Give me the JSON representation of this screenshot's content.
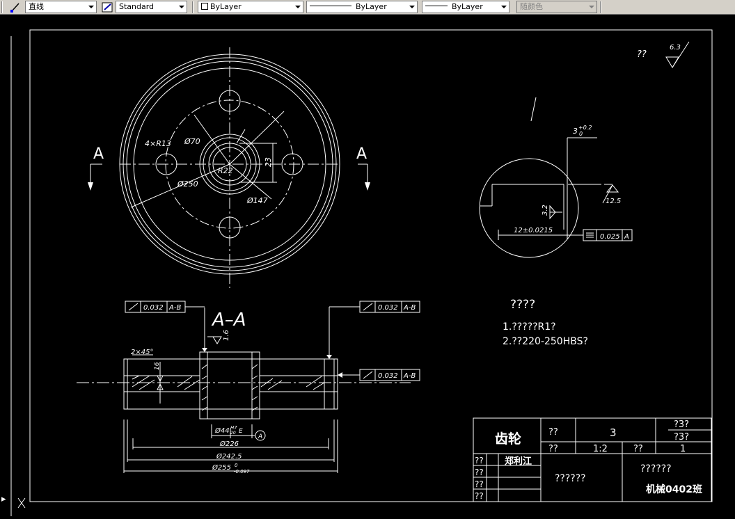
{
  "toolbar": {
    "command_combo": "直线",
    "style_combo": "Standard",
    "layer_combo": "ByLayer",
    "linetype_combo": "ByLayer",
    "lineweight_combo": "ByLayer",
    "color_combo": "随颜色"
  },
  "drawing": {
    "top_view": {
      "section_left": "A",
      "section_right": "A",
      "dim_4xr13": "4×R13",
      "dim_d70": "Ø70",
      "dim_r22": "R22",
      "dim_23": "23",
      "dim_d250": "Ø250",
      "dim_d147": "Ø147"
    },
    "detail": {
      "dim_3": "3",
      "dim_3_tol": "+0.2",
      "dim_3_tol_low": "0",
      "rough_12_5": "12.5",
      "rough_3_2": "3.2",
      "dim_12": "12±0.0215",
      "sym_tol": "0.025",
      "sym_datum": "A"
    },
    "roughness": {
      "label": "??",
      "value": "6.3"
    },
    "section_view": {
      "title": "A–A",
      "rough_1_6": "1.6",
      "chamfer": "2×45°",
      "rough_16": "16",
      "runout_tol": "0.032",
      "runout_datum": "A-B",
      "dim_d44": "Ø44",
      "dim_d44_tol": "H7",
      "dim_d44_tol2": "E",
      "dim_d44_sub": "20",
      "dim_d226": "Ø226",
      "dim_d242": "Ø242.5",
      "dim_d255": "Ø255",
      "dim_d255_tol": "0",
      "dim_d255_tol_low": "-0.097",
      "datum_a": "A"
    },
    "notes": {
      "title": "????",
      "line1": "1.?????R1?",
      "line2": "2.??220-250HBS?"
    },
    "title_block": {
      "part_name": "齿轮",
      "h1": "??",
      "qty": "3",
      "r1": "?3?",
      "r2": "?3?",
      "h2": "??",
      "scale": "1:2",
      "h3": "??",
      "one": "1",
      "lbl1": "??",
      "designer": "郑利江",
      "lbl2": "??",
      "lbl3": "??",
      "lbl4": "??",
      "school": "??????",
      "mid": "??????",
      "class_name": "机械0402班"
    }
  }
}
